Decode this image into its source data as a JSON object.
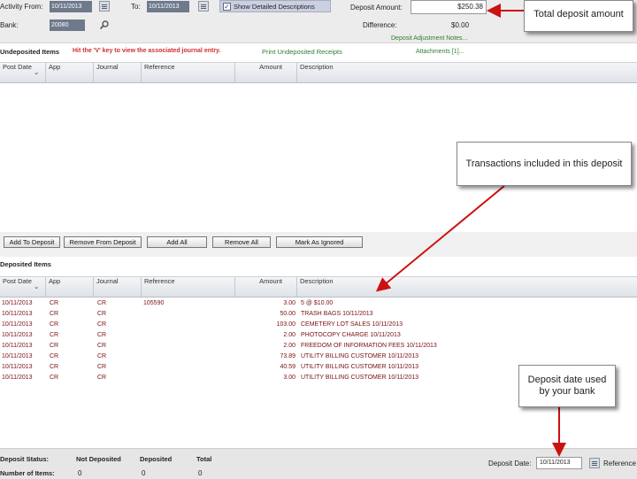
{
  "filters": {
    "activity_from_label": "Activity From:",
    "activity_from_value": "10/11/2013",
    "to_label": "To:",
    "to_value": "10/11/2013",
    "show_detailed_label": "Show Detailed Descriptions",
    "bank_label": "Bank:",
    "bank_value": "20080",
    "deposit_amount_label": "Deposit Amount:",
    "deposit_amount_value": "$250.38",
    "difference_label": "Difference:",
    "difference_value": "$0.00",
    "deposit_adjustment_link": "Deposit Adjustment Notes...",
    "attachments_link": "Attachments [1]..."
  },
  "undeposited": {
    "title": "Undeposited Items",
    "hint": "Hit the 'V' key to view the associated journal entry.",
    "print_link": "Print Undeposited Receipts",
    "columns": [
      "Post Date",
      "App",
      "Journal",
      "Reference",
      "Amount",
      "Description"
    ]
  },
  "buttons": {
    "add_to_deposit": "Add To Deposit",
    "remove_from_deposit": "Remove From Deposit",
    "add_all": "Add All",
    "remove_all": "Remove All",
    "mark_as_ignored": "Mark As Ignored"
  },
  "deposited": {
    "title": "Deposited Items",
    "columns": [
      "Post Date",
      "App",
      "Journal",
      "Reference",
      "Amount",
      "Description"
    ],
    "rows": [
      {
        "date": "10/11/2013",
        "app": "CR",
        "journal": "CR",
        "reference": "105590",
        "amount": "3.00",
        "description": "5 @ $10.00"
      },
      {
        "date": "10/11/2013",
        "app": "CR",
        "journal": "CR",
        "reference": "",
        "amount": "50.00",
        "description": "TRASH BAGS 10/11/2013"
      },
      {
        "date": "10/11/2013",
        "app": "CR",
        "journal": "CR",
        "reference": "",
        "amount": "103.00",
        "description": "CEMETERY LOT SALES 10/11/2013"
      },
      {
        "date": "10/11/2013",
        "app": "CR",
        "journal": "CR",
        "reference": "",
        "amount": "2.00",
        "description": "PHOTOCOPY CHARGE 10/11/2013"
      },
      {
        "date": "10/11/2013",
        "app": "CR",
        "journal": "CR",
        "reference": "",
        "amount": "2.00",
        "description": "FREEDOM OF INFORMATION FEES 10/11/2013"
      },
      {
        "date": "10/11/2013",
        "app": "CR",
        "journal": "CR",
        "reference": "",
        "amount": "73.89",
        "description": "UTILITY BILLING CUSTOMER 10/11/2013"
      },
      {
        "date": "10/11/2013",
        "app": "CR",
        "journal": "CR",
        "reference": "",
        "amount": "40.59",
        "description": "UTILITY BILLING CUSTOMER 10/11/2013"
      },
      {
        "date": "10/11/2013",
        "app": "CR",
        "journal": "CR",
        "reference": "",
        "amount": "3.00",
        "description": "UTILITY BILLING CUSTOMER 10/11/2013"
      }
    ]
  },
  "summary": {
    "deposit_status_label": "Deposit Status:",
    "number_of_items_label": "Number of Items:",
    "not_deposited_label": "Not Deposited",
    "deposited_label": "Deposited",
    "total_label": "Total",
    "not_deposited_count": "0",
    "deposited_count": "0",
    "total_count": "0",
    "deposit_date_label": "Deposit Date:",
    "deposit_date_value": "10/11/2013",
    "reference_label": "Reference"
  },
  "callouts": {
    "total_deposit": "Total deposit amount",
    "transactions": "Transactions included in this deposit",
    "deposit_date": "Deposit date used by your bank"
  },
  "colors": {
    "row_text": "#7a1010",
    "callout_arrow": "#cc1111",
    "link_green": "#2e7d32",
    "hint_red": "#d32f2f"
  }
}
